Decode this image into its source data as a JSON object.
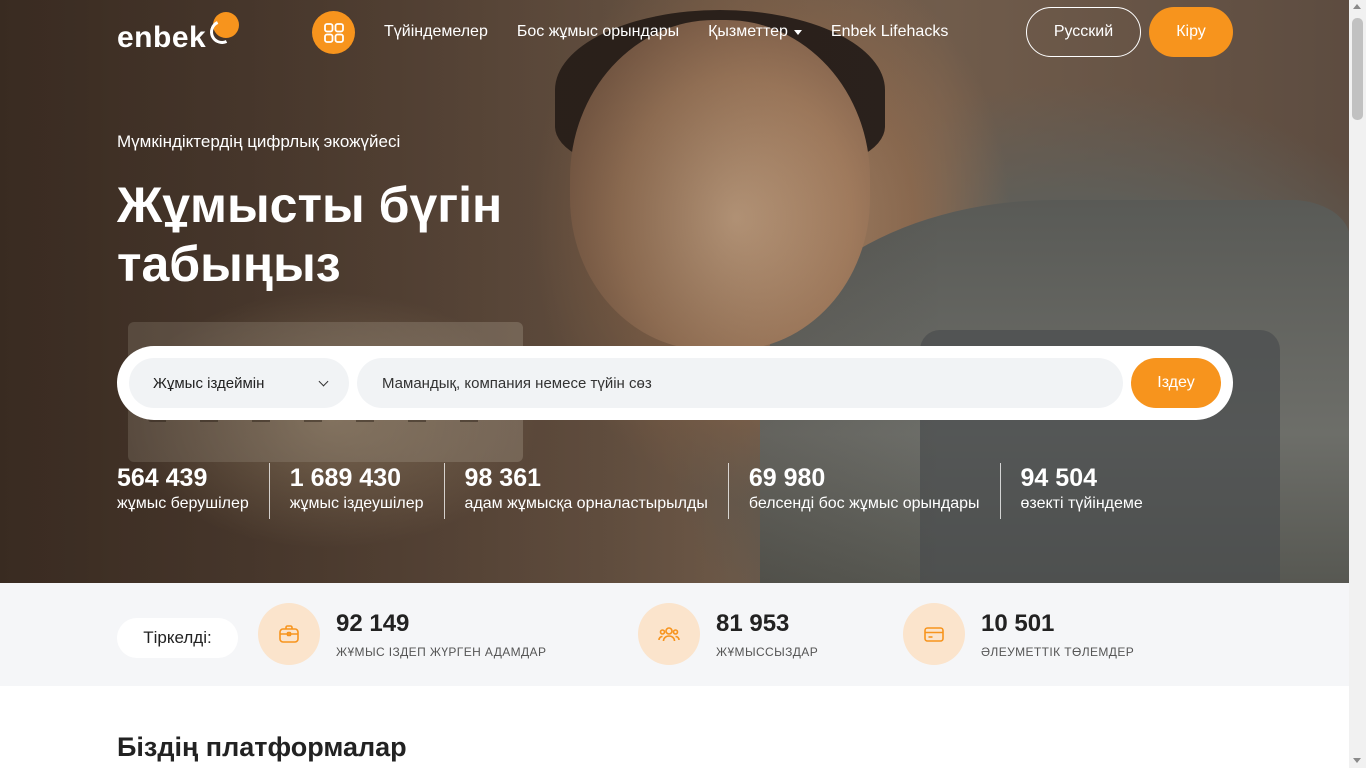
{
  "header": {
    "logo_text": "enbek",
    "nav": [
      {
        "label": "Түйіндемелер",
        "has_dropdown": false
      },
      {
        "label": "Бос жұмыс орындары",
        "has_dropdown": false
      },
      {
        "label": "Қызметтер",
        "has_dropdown": true
      },
      {
        "label": "Enbek Lifehacks",
        "has_dropdown": false
      }
    ],
    "language_button": "Русский",
    "login_button": "Кіру",
    "apps_icon": "grid-icon"
  },
  "hero": {
    "subtitle": "Мүмкіндіктердің цифрлық экожүйесі",
    "title": "Жұмысты бүгін табыңыз"
  },
  "search": {
    "mode_value": "Жұмыс іздеймін",
    "placeholder": "Мамандық, компания немесе түйін сөз",
    "button": "Іздеу"
  },
  "stats": [
    {
      "value": "564 439",
      "label": "жұмыс берушілер"
    },
    {
      "value": "1 689 430",
      "label": "жұмыс іздеушілер"
    },
    {
      "value": "98 361",
      "label": "адам жұмысқа орналастырылды"
    },
    {
      "value": "69 980",
      "label": "белсенді бос жұмыс орындары"
    },
    {
      "value": "94 504",
      "label": "өзекті түйіндеме"
    }
  ],
  "registered": {
    "label": "Тіркелді:",
    "items": [
      {
        "value": "92 149",
        "label": "ЖҰМЫС ІЗДЕП ЖҮРГЕН АДАМДАР",
        "icon": "briefcase-icon"
      },
      {
        "value": "81 953",
        "label": "ЖҰМЫССЫЗДАР",
        "icon": "people-icon"
      },
      {
        "value": "10 501",
        "label": "ӘЛЕУМЕТТІК ТӨЛЕМДЕР",
        "icon": "card-icon"
      }
    ]
  },
  "sections": {
    "platforms_title": "Біздің платформалар"
  },
  "colors": {
    "accent": "#f7941d",
    "icon_bg": "#fbe4cc",
    "band_bg": "#f5f6f8"
  }
}
